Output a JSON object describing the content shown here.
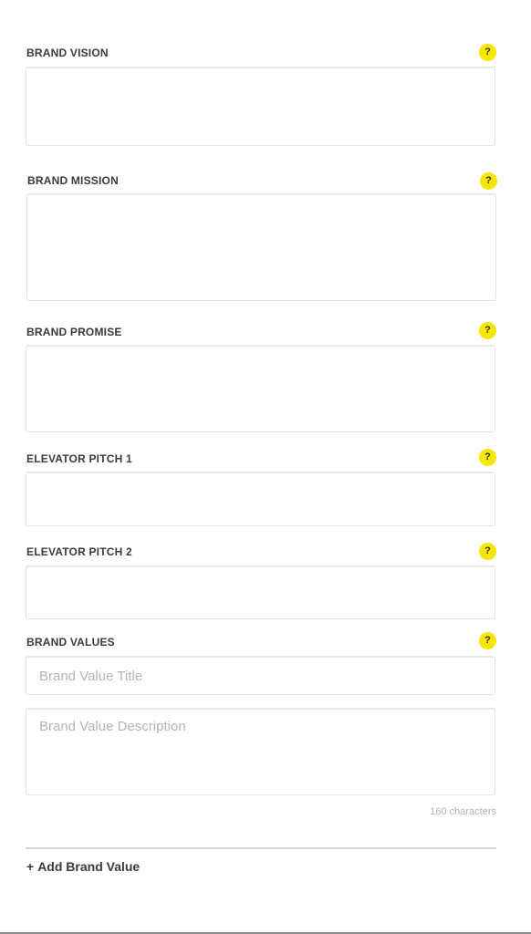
{
  "help_symbol": "?",
  "accent_color": "#f7e600",
  "fields": {
    "vision": {
      "label": "BRAND VISION"
    },
    "mission": {
      "label": "BRAND MISSION"
    },
    "promise": {
      "label": "BRAND PROMISE"
    },
    "pitch1": {
      "label": "ELEVATOR PITCH 1"
    },
    "pitch2": {
      "label": "ELEVATOR PITCH 2"
    },
    "values": {
      "label": "BRAND VALUES",
      "title_placeholder": "Brand Value Title",
      "description_placeholder": "Brand Value Description",
      "char_limit_text": "160 characters",
      "add_button_icon": "+",
      "add_button_label": "Add Brand Value"
    }
  }
}
